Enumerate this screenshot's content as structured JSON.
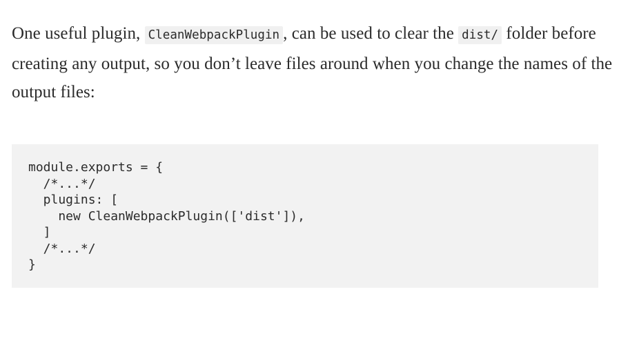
{
  "paragraph": {
    "text1": "One useful plugin, ",
    "code1": "CleanWebpackPlugin",
    "text2": ", can be used to clear the ",
    "code2": "dist/",
    "text3": " folder before creating any output, so you don’t leave files around when you change the names of the output files:"
  },
  "code_block": {
    "lines": [
      "module.exports = {",
      "  /*...*/",
      "  plugins: [",
      "    new CleanWebpackPlugin(['dist']),",
      "  ]",
      "  /*...*/",
      "}"
    ]
  }
}
